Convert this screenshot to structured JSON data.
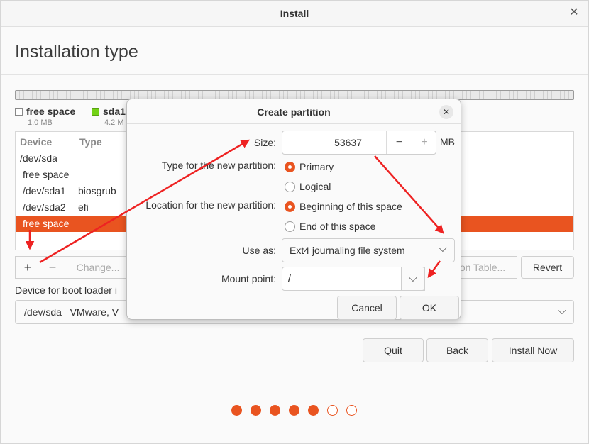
{
  "window": {
    "title": "Install"
  },
  "page": {
    "title": "Installation type"
  },
  "legend": [
    {
      "name": "free space",
      "size": "1.0 MB",
      "color": "#ffffff"
    },
    {
      "name": "sda1",
      "size": "4.2 M",
      "color": "#73d216"
    }
  ],
  "table": {
    "headers": {
      "device": "Device",
      "type": "Type"
    },
    "rows": [
      {
        "device": "/dev/sda",
        "type": ""
      },
      {
        "device": "free space",
        "type": ""
      },
      {
        "device": "/dev/sda1",
        "type": "biosgrub"
      },
      {
        "device": "/dev/sda2",
        "type": "efi"
      },
      {
        "device": "free space",
        "type": "",
        "selected": true
      }
    ]
  },
  "toolbar": {
    "add": "+",
    "remove": "−",
    "change": "Change...",
    "new_table": "on Table...",
    "revert": "Revert"
  },
  "bootloader": {
    "label": "Device for boot loader i",
    "value": "/dev/sda   VMware, V"
  },
  "buttons": {
    "quit": "Quit",
    "back": "Back",
    "install_now": "Install Now"
  },
  "progress": {
    "total": 7,
    "completed": 5
  },
  "dialog": {
    "title": "Create partition",
    "size_label": "Size:",
    "size_value": "53637",
    "size_unit": "MB",
    "type_label": "Type for the new partition:",
    "type_options": [
      "Primary",
      "Logical"
    ],
    "location_label": "Location for the new partition:",
    "location_options": [
      "Beginning of this space",
      "End of this space"
    ],
    "use_as_label": "Use as:",
    "use_as_value": "Ext4 journaling file system",
    "mount_label": "Mount point:",
    "mount_value": "/",
    "cancel": "Cancel",
    "ok": "OK"
  },
  "colors": {
    "accent": "#e95420",
    "annotation": "#ee2222"
  }
}
